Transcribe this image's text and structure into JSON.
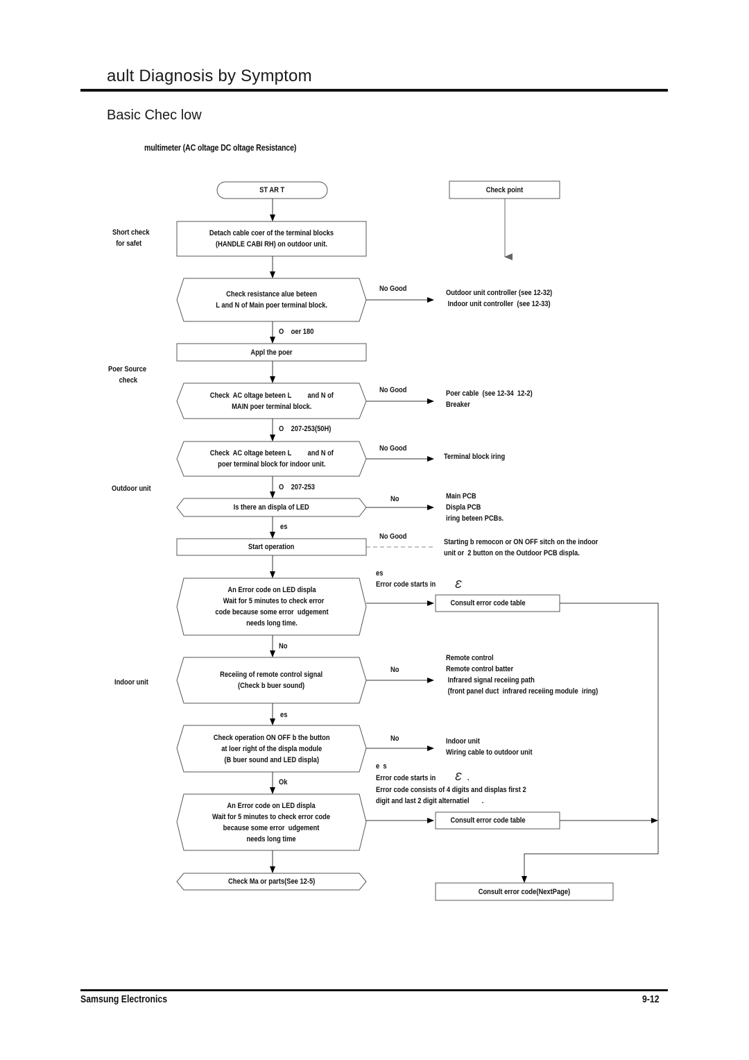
{
  "header": {
    "title": "ault Diagnosis by Symptom",
    "subtitle": "Basic Chec   low",
    "tools_needed": "multimeter (AC oltage  DC oltage  Resistance)"
  },
  "side_labels": {
    "short_check": "Short check\n  for safet",
    "power_source": "Poer Source\n      check",
    "outdoor_unit": "Outdoor unit",
    "indoor_unit": "Indoor unit"
  },
  "flow": {
    "start": "ST AR T",
    "detach": "Detach cable coer of the terminal blocks\n(HANDLE CABI RH) on outdoor unit.",
    "check_resistance": "Check resistance alue beteen\nL and N of Main poer terminal block.",
    "ok_over_180": "O    oer 180",
    "apply_power": "Appl the poer",
    "check_ac_main": "Check  AC oltage beteen L         and N of\nMAIN poer terminal block.",
    "ok_207_253_50h": "O    207-253(50H)",
    "check_ac_indoor": "Check  AC oltage beteen L         and N of\npoer terminal block for indoor unit.",
    "ok_207_253": "O    207-253",
    "led_display": "Is there an displa of LED",
    "yes1": "es",
    "start_operation": "Start operation",
    "error_code_led": "An Error code on LED displa\n  Wait for 5 minutes to check error\ncode because some error  udgement\nneeds long time.",
    "no1": "No",
    "remote_signal": "Receiing of remote control signal\n(Check b buer sound)",
    "yes2": "es",
    "check_on_off": "Check operation ON OFF b the button\nat loer right of the displa module\n(B buer sound and LED displa)",
    "ok": "Ok",
    "error_code_led2": "An Error code on LED displa\nWait for 5 minutes to check error code\nbecause some error  udgement\nneeds long time",
    "check_major": "Check Ma or parts(See 12-5)"
  },
  "branches": {
    "no_good": "No Good",
    "no": "No",
    "yes_error_e": "es\nError code starts in",
    "yes_s": "e  s",
    "error_starts_e2": "Error code starts in",
    "error_consists": "Error code consists of 4 digits and displas first 2\ndigit and last 2 digit alternatiel       .",
    "e_glyph": "Ɛ",
    "period": "."
  },
  "check_points": {
    "header": "Check point",
    "controllers": "Outdoor unit controller (see 12-32)\n Indoor unit controller  (see 12-33)",
    "power_cable": "Poer cable  (see 12-34  12-2)\nBreaker",
    "terminal_wiring": "Terminal block iring",
    "pcbs": "Main PCB\nDispla PCB\niring beteen PCBs.",
    "starting": "Starting b remocon or ON OFF sitch on the indoor\nunit or  2 button on the Outdoor PCB displa.",
    "consult_table_1": "Consult error code table",
    "remote": "Remote control\nRemote control batter\n Infrared signal receiing path\n (front panel duct  infrared receiing module  iring)",
    "indoor_wiring": "Indoor unit\nWiring cable to outdoor unit",
    "consult_table_2": "Consult error code table",
    "consult_next": "Consult error code(NextPage)"
  },
  "footer": {
    "company": "Samsung Electronics",
    "page": "9-12"
  }
}
